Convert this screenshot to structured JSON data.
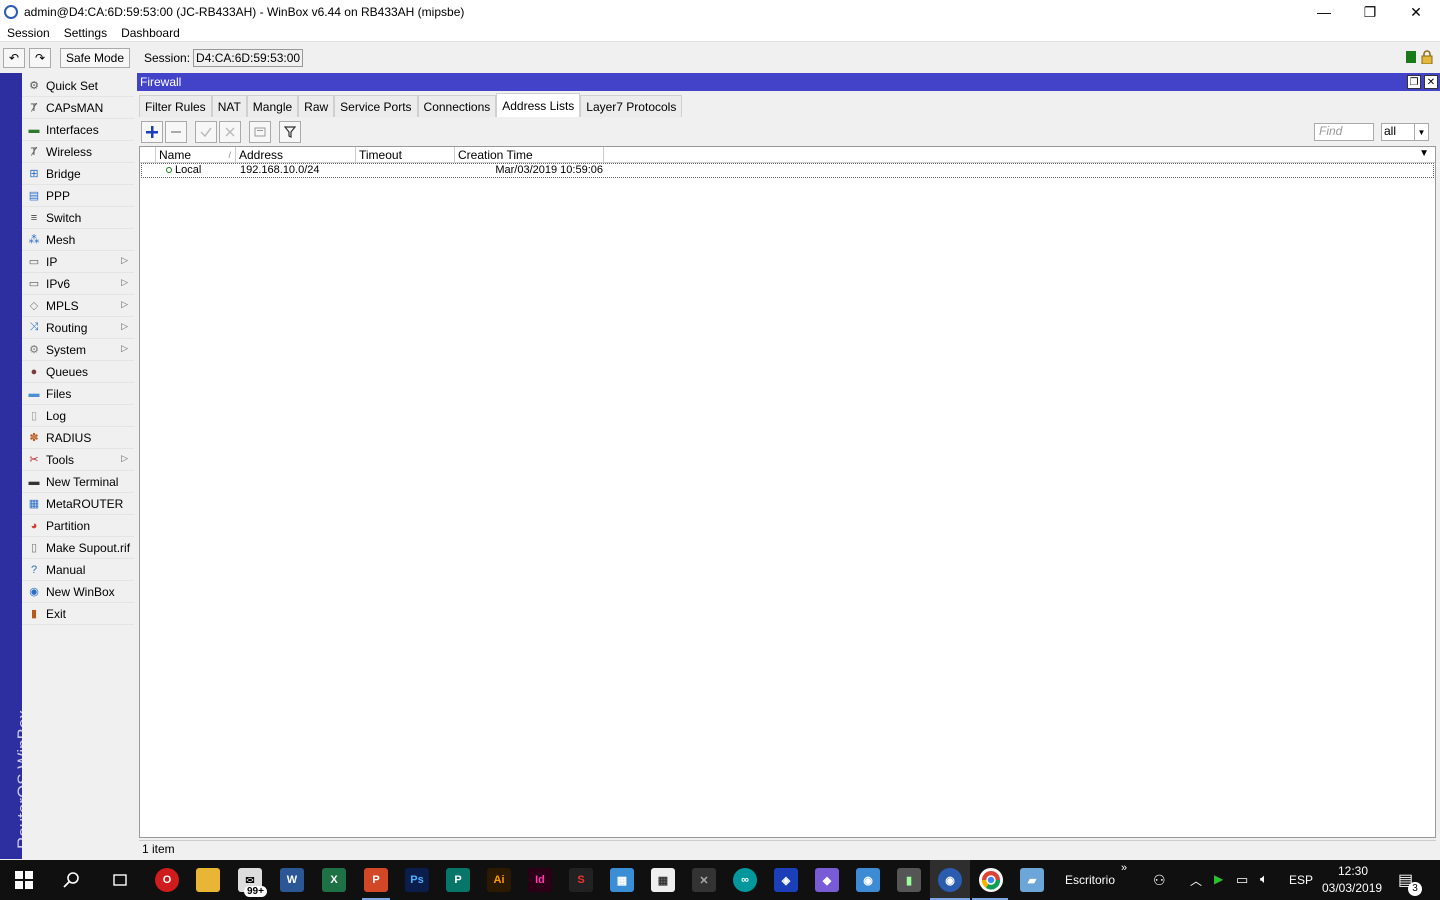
{
  "window": {
    "title": "admin@D4:CA:6D:59:53:00 (JC-RB433AH) - WinBox v6.44 on RB433AH (mipsbe)",
    "minimize": "—",
    "maximize": "❐",
    "close": "✕"
  },
  "menubar": [
    "Session",
    "Settings",
    "Dashboard"
  ],
  "toolbar": {
    "undo": "↶",
    "redo": "↷",
    "safe_mode": "Safe Mode",
    "session_label": "Session:",
    "session_value": "D4:CA:6D:59:53:00"
  },
  "brand": "RouterOS WinBox",
  "sidebar": {
    "items": [
      {
        "label": "Quick Set",
        "icon": "quickset-icon",
        "glyph": "⚙",
        "color": "#555",
        "submenu": false
      },
      {
        "label": "CAPsMAN",
        "icon": "capsman-icon",
        "glyph": "Ⱦ",
        "color": "#555",
        "submenu": false
      },
      {
        "label": "Interfaces",
        "icon": "interfaces-icon",
        "glyph": "▬",
        "color": "#2c7a2c",
        "submenu": false
      },
      {
        "label": "Wireless",
        "icon": "wireless-icon",
        "glyph": "Ⱦ",
        "color": "#555",
        "submenu": false
      },
      {
        "label": "Bridge",
        "icon": "bridge-icon",
        "glyph": "⊞",
        "color": "#2a6dc9",
        "submenu": false
      },
      {
        "label": "PPP",
        "icon": "ppp-icon",
        "glyph": "▤",
        "color": "#2a6dc9",
        "submenu": false
      },
      {
        "label": "Switch",
        "icon": "switch-icon",
        "glyph": "≡",
        "color": "#444",
        "submenu": false
      },
      {
        "label": "Mesh",
        "icon": "mesh-icon",
        "glyph": "⁂",
        "color": "#2a6dc9",
        "submenu": false
      },
      {
        "label": "IP",
        "icon": "ip-icon",
        "glyph": "▭",
        "color": "#555",
        "submenu": true
      },
      {
        "label": "IPv6",
        "icon": "ipv6-icon",
        "glyph": "▭",
        "color": "#555",
        "submenu": true
      },
      {
        "label": "MPLS",
        "icon": "mpls-icon",
        "glyph": "◇",
        "color": "#888",
        "submenu": true
      },
      {
        "label": "Routing",
        "icon": "routing-icon",
        "glyph": "⤨",
        "color": "#2a6dc9",
        "submenu": true
      },
      {
        "label": "System",
        "icon": "system-icon",
        "glyph": "⚙",
        "color": "#777",
        "submenu": true
      },
      {
        "label": "Queues",
        "icon": "queues-icon",
        "glyph": "●",
        "color": "#7a3b3b",
        "submenu": false
      },
      {
        "label": "Files",
        "icon": "files-icon",
        "glyph": "▬",
        "color": "#4a8fd4",
        "submenu": false
      },
      {
        "label": "Log",
        "icon": "log-icon",
        "glyph": "▯",
        "color": "#999",
        "submenu": false
      },
      {
        "label": "RADIUS",
        "icon": "radius-icon",
        "glyph": "✽",
        "color": "#b55a1d",
        "submenu": false
      },
      {
        "label": "Tools",
        "icon": "tools-icon",
        "glyph": "✂",
        "color": "#b02020",
        "submenu": true
      },
      {
        "label": "New Terminal",
        "icon": "terminal-icon",
        "glyph": "▬",
        "color": "#333",
        "submenu": false
      },
      {
        "label": "MetaROUTER",
        "icon": "metarouter-icon",
        "glyph": "▦",
        "color": "#2a6dc9",
        "submenu": false
      },
      {
        "label": "Partition",
        "icon": "partition-icon",
        "glyph": "◕",
        "color": "#d23c2c",
        "submenu": false
      },
      {
        "label": "Make Supout.rif",
        "icon": "supout-icon",
        "glyph": "▯",
        "color": "#777",
        "submenu": false
      },
      {
        "label": "Manual",
        "icon": "manual-icon",
        "glyph": "?",
        "color": "#2a6dc9",
        "submenu": false
      },
      {
        "label": "New WinBox",
        "icon": "winbox-icon",
        "glyph": "◉",
        "color": "#2a6dc9",
        "submenu": false
      },
      {
        "label": "Exit",
        "icon": "exit-icon",
        "glyph": "▮",
        "color": "#b55a1d",
        "submenu": false
      }
    ]
  },
  "firewall": {
    "title": "Firewall",
    "tabs": [
      "Filter Rules",
      "NAT",
      "Mangle",
      "Raw",
      "Service Ports",
      "Connections",
      "Address Lists",
      "Layer7 Protocols"
    ],
    "active_tab": "Address Lists",
    "find_placeholder": "Find",
    "filter_value": "all",
    "columns": [
      "Name",
      "Address",
      "Timeout",
      "Creation Time"
    ],
    "sort_indicator": "/",
    "rows": [
      {
        "name": "Local",
        "address": "192.168.10.0/24",
        "timeout": "",
        "creation_time": "Mar/03/2019 10:59:06"
      }
    ],
    "status": "1 item"
  },
  "taskbar": {
    "mail_badge": "99+",
    "desktop_label": "Escritorio",
    "language": "ESP",
    "time": "12:30",
    "date": "03/03/2019",
    "notification_count": "3"
  }
}
